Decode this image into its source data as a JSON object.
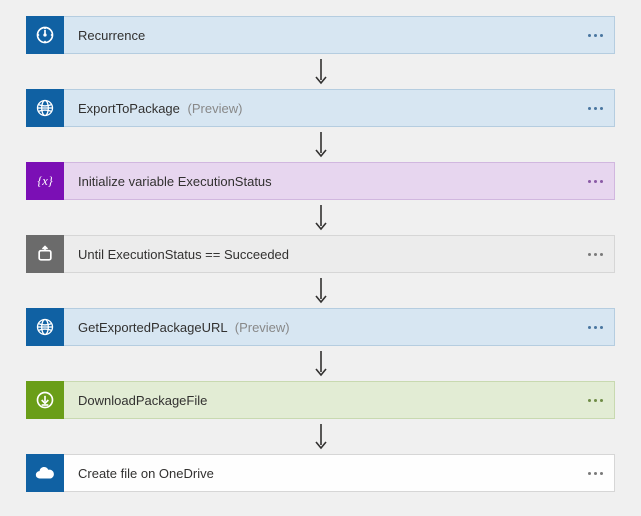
{
  "steps": [
    {
      "id": "recurrence",
      "label": "Recurrence",
      "suffix": "",
      "icon": "clock",
      "variant": "blue"
    },
    {
      "id": "export-pkg",
      "label": "ExportToPackage",
      "suffix": "(Preview)",
      "icon": "globe",
      "variant": "blue"
    },
    {
      "id": "init-var",
      "label": "Initialize variable ExecutionStatus",
      "suffix": "",
      "icon": "brace",
      "variant": "purple"
    },
    {
      "id": "until",
      "label": "Until ExecutionStatus == Succeeded",
      "suffix": "",
      "icon": "loop",
      "variant": "gray"
    },
    {
      "id": "get-url",
      "label": "GetExportedPackageURL",
      "suffix": "(Preview)",
      "icon": "globe",
      "variant": "blue"
    },
    {
      "id": "download",
      "label": "DownloadPackageFile",
      "suffix": "",
      "icon": "download",
      "variant": "green"
    },
    {
      "id": "create-file",
      "label": "Create file on OneDrive",
      "suffix": "",
      "icon": "cloud",
      "variant": "white"
    }
  ]
}
